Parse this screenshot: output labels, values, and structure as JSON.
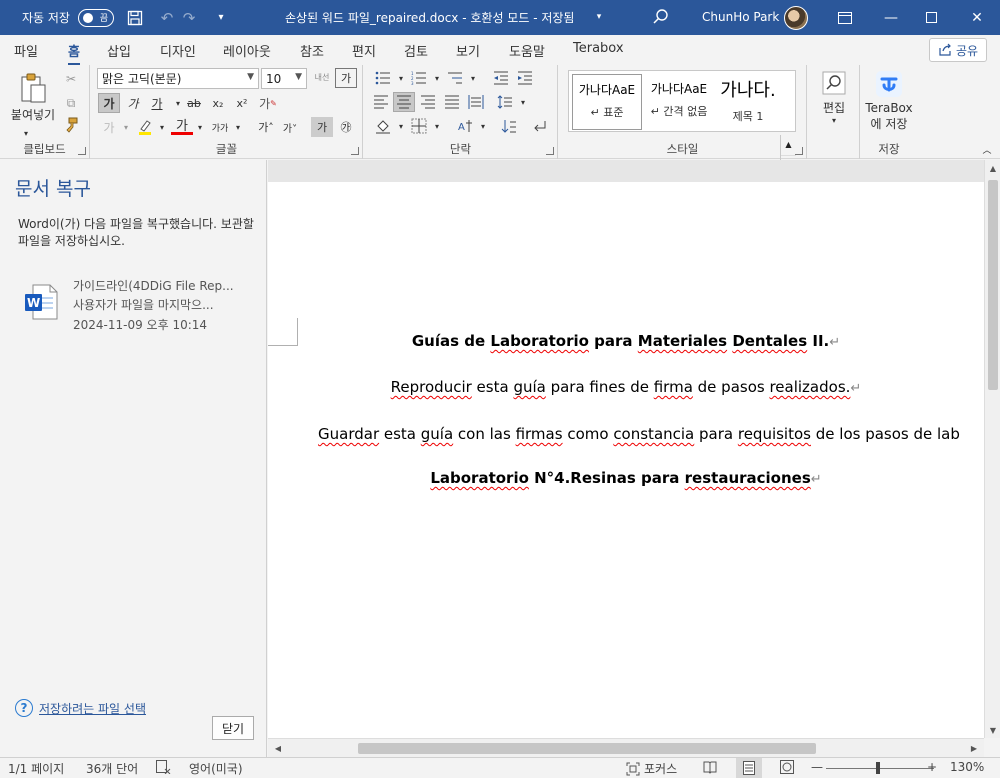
{
  "titlebar": {
    "autosave_label": "자동 저장",
    "autosave_state": "끔",
    "title": "손상된 워드 파일_repaired.docx  -  호환성 모드 - 저장됨",
    "user_name": "ChunHo Park"
  },
  "menu": {
    "tabs": [
      "파일",
      "홈",
      "삽입",
      "디자인",
      "레이아웃",
      "참조",
      "편지",
      "검토",
      "보기",
      "도움말",
      "Terabox"
    ],
    "active": "홈",
    "share": "공유"
  },
  "ribbon": {
    "clipboard": {
      "label": "클립보드",
      "paste": "붙여넣기"
    },
    "font": {
      "label": "글꼴",
      "font_name": "맑은 고딕(본문)",
      "font_size": "10",
      "bold": "가",
      "italic": "가",
      "underline": "가"
    },
    "paragraph": {
      "label": "단락"
    },
    "styles": {
      "label": "스타일",
      "items": [
        {
          "sample": "가나다AaE",
          "name": "↵ 표준"
        },
        {
          "sample": "가나다AaE",
          "name": "↵ 간격 없음"
        },
        {
          "sample": "가나다.",
          "name": "제목 1"
        }
      ]
    },
    "editing": {
      "label": "편집"
    },
    "save": {
      "label": "저장",
      "terabox": "TeraBox",
      "terabox_sub": "에 저장"
    }
  },
  "recovery": {
    "title": "문서 복구",
    "message": "Word이(가) 다음 파일을 복구했습니다. 보관할 파일을 저장하십시오.",
    "file": {
      "name": "가이드라인(4DDiG File Rep...",
      "desc": "사용자가 파일을 마지막으...",
      "date": "2024-11-09 오후 10:14"
    },
    "link": "저장하려는 파일 선택",
    "close": "닫기"
  },
  "document": {
    "title_a": "Guías",
    "title_b": " de ",
    "title_c": "Laboratorio",
    "title_d": " para ",
    "title_e": "Materiales",
    "title_f": " ",
    "title_g": "Dentales",
    "title_h": " II.",
    "line2_a": "Reproducir",
    "line2_b": " esta ",
    "line2_c": "guía",
    "line2_d": " para fines de ",
    "line2_e": "firma",
    "line2_f": " de pasos ",
    "line2_g": "realizados.",
    "line3_a": "Guardar",
    "line3_b": " esta ",
    "line3_c": "guía",
    "line3_d": " con las ",
    "line3_e": "firmas",
    "line3_f": " como ",
    "line3_g": "constancia",
    "line3_h": " para ",
    "line3_i": "requisitos",
    "line3_j": " de los pasos de lab",
    "line4_a": "Laboratorio",
    "line4_b": " N°4.Resinas para ",
    "line4_c": "restauraciones",
    "pilcrow": "↵"
  },
  "status": {
    "page": "1/1 페이지",
    "words": "36개 단어",
    "language": "영어(미국)",
    "focus": "포커스",
    "zoom": "130%"
  }
}
